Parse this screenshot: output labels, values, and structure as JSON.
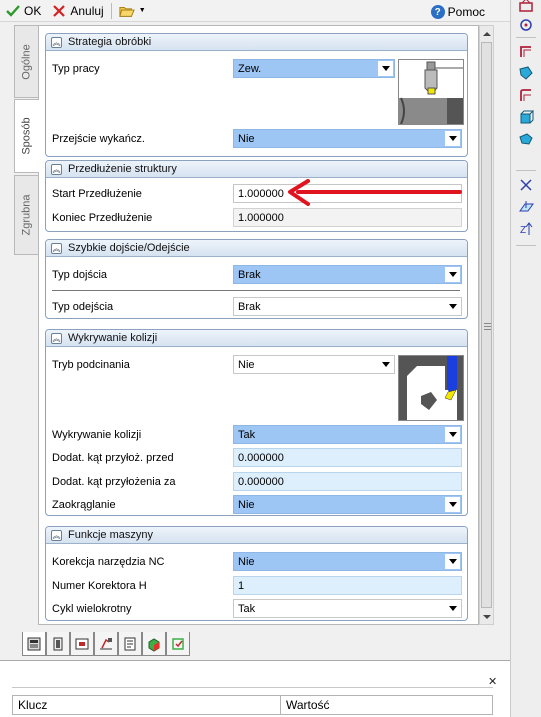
{
  "toolbar": {
    "ok_label": "OK",
    "cancel_label": "Anuluj",
    "help_label": "Pomoc"
  },
  "tabs": [
    {
      "label": "Ogólne"
    },
    {
      "label": "Sposób"
    },
    {
      "label": "Zgrubna"
    }
  ],
  "groups": {
    "strategy": {
      "title": "Strategia obróbki",
      "work_type_label": "Typ pracy",
      "work_type_value": "Zew.",
      "finish_pass_label": "Przejście wykańcz.",
      "finish_pass_value": "Nie"
    },
    "extension": {
      "title": "Przedłużenie struktury",
      "start_label": "Start Przedłużenie",
      "start_value": "1.000000",
      "end_label": "Koniec Przedłużenie",
      "end_value": "1.000000"
    },
    "approach": {
      "title": "Szybkie dojście/Odejście",
      "approach_label": "Typ dojścia",
      "approach_value": "Brak",
      "retract_label": "Typ odejścia",
      "retract_value": "Brak"
    },
    "collision": {
      "title": "Wykrywanie kolizji",
      "undercut_label": "Tryb podcinania",
      "undercut_value": "Nie",
      "detect_label": "Wykrywanie kolizji",
      "detect_value": "Tak",
      "angle_before_label": "Dodat. kąt przyłoż. przed",
      "angle_before_value": "0.000000",
      "angle_after_label": "Dodat. kąt przyłożenia za",
      "angle_after_value": "0.000000",
      "rounding_label": "Zaokrąglanie",
      "rounding_value": "Nie"
    },
    "machine": {
      "title": "Funkcje maszyny",
      "nc_comp_label": "Korekcja narzędzia NC",
      "nc_comp_value": "Nie",
      "corrector_label": "Numer Korektora H",
      "corrector_value": "1",
      "multi_cycle_label": "Cykl wielokrotny",
      "multi_cycle_value": "Tak"
    }
  },
  "kv_table": {
    "col_key": "Klucz",
    "col_value": "Wartość"
  },
  "colors": {
    "select_bg": "#9dc6f5",
    "input_bg": "#ddeffd",
    "group_header": "#d5e2f0",
    "annotation_arrow": "#e0141e"
  }
}
